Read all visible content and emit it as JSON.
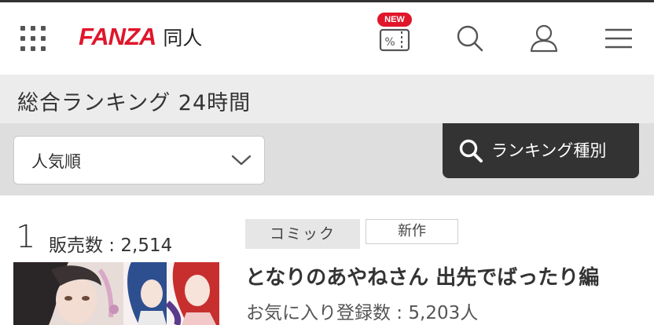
{
  "header": {
    "logo_brand": "FANZA",
    "logo_section": "同人",
    "new_badge": "NEW",
    "coupon_symbol": "%",
    "icons": [
      "grid-menu-icon",
      "coupon-icon",
      "search-icon",
      "user-icon",
      "hamburger-menu-icon"
    ]
  },
  "page": {
    "title": "総合ランキング 24時間"
  },
  "filters": {
    "sort_selected": "人気順",
    "ranking_type_button": "ランキング種別"
  },
  "items": [
    {
      "rank": "1",
      "sales": "販売数 : 2,514",
      "tags": [
        "コミック",
        "新作"
      ],
      "title": "となりのあやねさん 出先でばったり編",
      "favorites": "お気に入り登録数 : 5,203人"
    }
  ],
  "colors": {
    "brand_red": "#e0162b",
    "dark_button": "#333333",
    "title_band": "#ececec",
    "filter_band": "#dedede"
  }
}
